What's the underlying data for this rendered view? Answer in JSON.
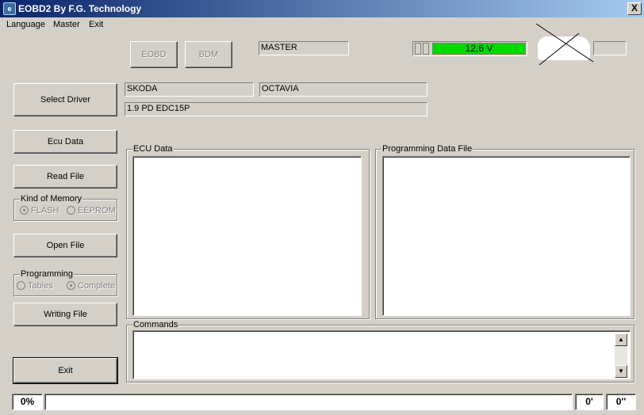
{
  "window": {
    "title": "EOBD2 By F.G. Technology",
    "close_label": "X"
  },
  "menu": [
    "Language",
    "Master",
    "Exit"
  ],
  "toolbar": {
    "eobd_label": "EOBD",
    "bdm_label": "BDM",
    "mode_value": "MASTER",
    "voltage": "12,6 V"
  },
  "vehicle": {
    "make": "SKODA",
    "model": "OCTAVIA",
    "engine": "1.9 PD EDC15P"
  },
  "buttons": {
    "select_driver": "Select Driver",
    "ecu_data": "Ecu Data",
    "read_file": "Read File",
    "open_file": "Open File",
    "writing_file": "Writing File",
    "exit": "Exit"
  },
  "memory": {
    "label": "Kind of Memory",
    "flash": "FLASH",
    "eeprom": "EEPROM",
    "selected": "FLASH"
  },
  "programming": {
    "label": "Programming",
    "tables": "Tables",
    "complete": "Complete",
    "selected": "Complete"
  },
  "panels": {
    "ecu_data": "ECU Data",
    "programming_data_file": "Programming Data File",
    "commands": "Commands"
  },
  "status": {
    "progress": "0%",
    "minutes": "0'",
    "seconds": "0''"
  },
  "colors": {
    "voltage_ok": "#00d800",
    "title_start": "#0a246a",
    "title_end": "#a6caf0"
  }
}
